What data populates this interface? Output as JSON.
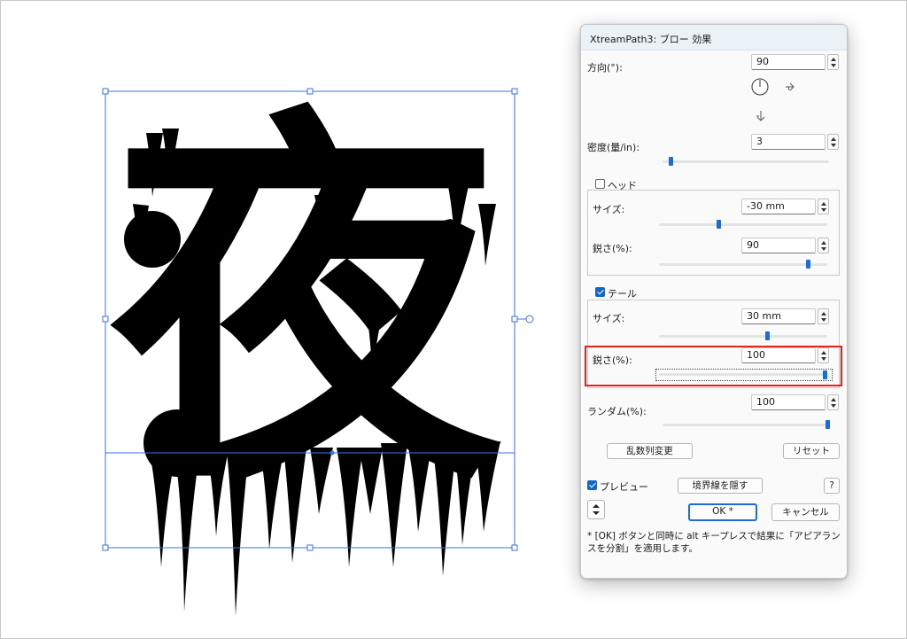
{
  "dialog": {
    "title": "XtreamPath3: ブロー 効果",
    "direction": {
      "label": "方向(°):",
      "value": "90"
    },
    "density": {
      "label": "密度(量/in):",
      "value": "3",
      "slider": 0.05
    },
    "head": {
      "label": "ヘッド",
      "checked": false,
      "size_label": "サイズ:",
      "size_value": "-30 mm",
      "size_slider": 0.45,
      "sharp_label": "鋭さ(%):",
      "sharp_value": "90",
      "sharp_slider": 0.9
    },
    "tail": {
      "label": "テール",
      "checked": true,
      "size_label": "サイズ:",
      "size_value": "30 mm",
      "size_slider": 0.6,
      "sharp_label": "鋭さ(%):",
      "sharp_value": "100",
      "sharp_slider": 1.0
    },
    "random": {
      "label": "ランダム(%):",
      "value": "100",
      "slider": 1.0
    },
    "shuffle_button": "乱数列変更",
    "reset_button": "リセット",
    "preview": {
      "label": "プレビュー",
      "checked": true
    },
    "hide_bounds_button": "境界線を隠す",
    "help_button": "?",
    "ok_button": "OK *",
    "cancel_button": "キャンセル",
    "note": "* [OK] ボタンと同時に alt キープレスで結果に「アピアランスを分割」を適用します。",
    "colors": {
      "accent": "#1a6dd8",
      "highlight": "#e5231e",
      "titlebar": "#eaf2f8"
    }
  },
  "canvas": {
    "artwork": "夜",
    "selection_color": "#3b73e8",
    "glyph_color": "#000000"
  }
}
